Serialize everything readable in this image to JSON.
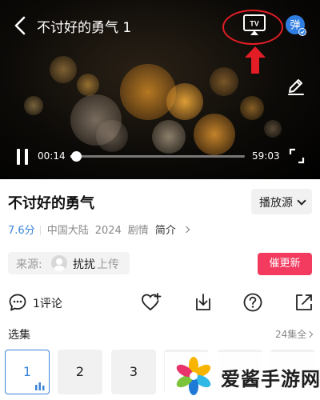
{
  "player": {
    "title": "不讨好的勇气 1",
    "cast_icon_text": "TV",
    "danmu_icon_text": "弹",
    "current_time": "00:14",
    "total_time": "59:03",
    "progress": 0.004
  },
  "details": {
    "title": "不讨好的勇气",
    "source_button": "播放源",
    "rating": "7.6分",
    "region": "中国大陆",
    "year": "2024",
    "genre": "剧情",
    "intro_link": "简介"
  },
  "uploader": {
    "label": "来源:",
    "name": "扰扰",
    "suffix": "上传"
  },
  "urge_button": "催更新",
  "actions": {
    "comment_label": "1评论",
    "icons": [
      "comment-icon",
      "favorite-plus-icon",
      "download-icon",
      "help-icon",
      "share-icon"
    ]
  },
  "episodes": {
    "label": "选集",
    "count": "24集全",
    "items": [
      "1",
      "2",
      "3"
    ]
  },
  "watermark": {
    "text": "爱酱手游网"
  },
  "colors": {
    "accent_blue": "#3a84d9",
    "urge_red": "#f33b5f",
    "highlight_red": "#e21d25"
  }
}
